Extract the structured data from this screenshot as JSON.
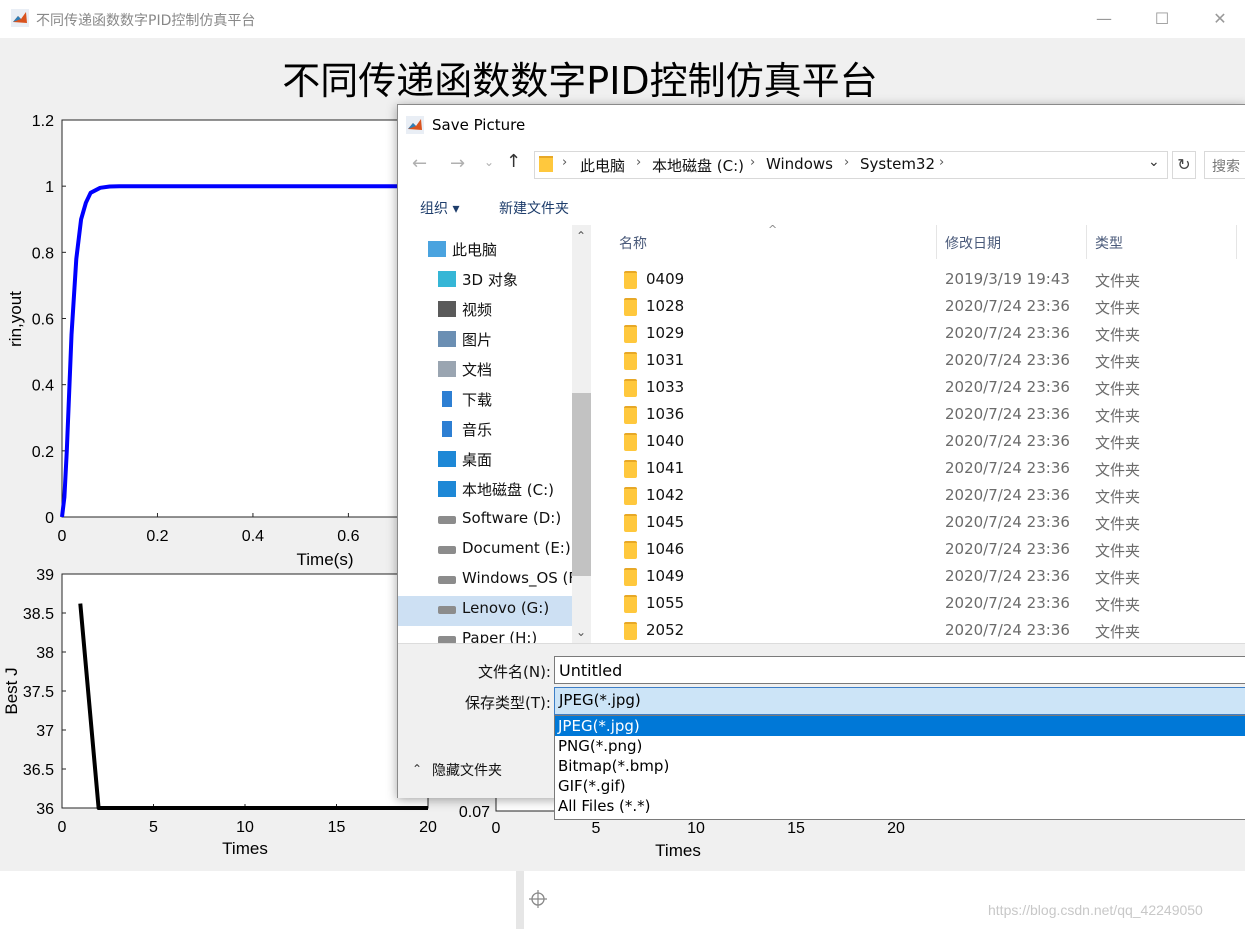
{
  "figure": {
    "window_title": "不同传递函数数字PID控制仿真平台",
    "heading": "不同传递函数数字PID控制仿真平台",
    "window_buttons": {
      "minimize": "—",
      "maximize": "☐",
      "close": "✕"
    }
  },
  "chart_data": [
    {
      "type": "line",
      "name": "response",
      "xlabel": "Time(s)",
      "ylabel": "rin,yout",
      "x_ticks": [
        "0",
        "0.2",
        "0.4",
        "0.6"
      ],
      "y_ticks": [
        "0",
        "0.2",
        "0.4",
        "0.6",
        "0.8",
        "1",
        "1.2"
      ],
      "xlim": [
        0,
        0.75
      ],
      "ylim": [
        0,
        1.2
      ],
      "series": [
        {
          "color": "#0000ff",
          "x": [
            0,
            0.005,
            0.01,
            0.02,
            0.03,
            0.04,
            0.05,
            0.06,
            0.08,
            0.1,
            0.12,
            0.15,
            0.2,
            0.4,
            0.6,
            0.75
          ],
          "y": [
            0,
            0.06,
            0.2,
            0.55,
            0.78,
            0.9,
            0.95,
            0.98,
            0.995,
            0.999,
            1.0,
            1.0,
            1.0,
            1.0,
            1.0,
            1.0
          ]
        }
      ]
    },
    {
      "type": "line",
      "name": "best-j",
      "xlabel": "Times",
      "ylabel": "Best J",
      "x_ticks": [
        "0",
        "5",
        "10",
        "15",
        "20"
      ],
      "y_ticks": [
        "36",
        "36.5",
        "37",
        "37.5",
        "38",
        "38.5",
        "39"
      ],
      "xlim": [
        0,
        20
      ],
      "ylim": [
        36,
        39
      ],
      "series": [
        {
          "color": "#000000",
          "x": [
            1,
            2,
            3,
            5,
            10,
            15,
            20
          ],
          "y": [
            38.62,
            36.0,
            36.0,
            36.0,
            36.0,
            36.0,
            36.0
          ]
        }
      ]
    },
    {
      "type": "line",
      "name": "partial-third",
      "xlabel": "Times",
      "x_ticks": [
        "0",
        "5",
        "10",
        "15",
        "20"
      ],
      "y_ticks": [
        "0.07"
      ],
      "xlim": [
        0,
        20
      ]
    }
  ],
  "dialog": {
    "title": "Save Picture",
    "breadcrumb": [
      "此电脑",
      "本地磁盘 (C:)",
      "Windows",
      "System32"
    ],
    "search_placeholder": "搜索",
    "toolbar": {
      "organize": "组织 ▾",
      "new_folder": "新建文件夹"
    },
    "nav_items": [
      {
        "label": "此电脑",
        "icon": "computer-icon"
      },
      {
        "label": "3D 对象",
        "icon": "3d-objects-icon"
      },
      {
        "label": "视频",
        "icon": "video-icon"
      },
      {
        "label": "图片",
        "icon": "pictures-icon"
      },
      {
        "label": "文档",
        "icon": "documents-icon"
      },
      {
        "label": "下载",
        "icon": "download-icon"
      },
      {
        "label": "音乐",
        "icon": "music-icon"
      },
      {
        "label": "桌面",
        "icon": "desktop-icon"
      },
      {
        "label": "本地磁盘 (C:)",
        "icon": "windows-drive-icon",
        "selected": true
      },
      {
        "label": "Software (D:)",
        "icon": "drive-icon"
      },
      {
        "label": "Document (E:)",
        "icon": "drive-icon"
      },
      {
        "label": "Windows_OS (F",
        "icon": "drive-icon"
      },
      {
        "label": "Lenovo (G:)",
        "icon": "drive-icon"
      },
      {
        "label": "Paper (H:)",
        "icon": "drive-icon"
      }
    ],
    "columns": {
      "name": "名称",
      "date": "修改日期",
      "type": "类型"
    },
    "files": [
      {
        "name": "0409",
        "date": "2019/3/19 19:43",
        "type": "文件夹"
      },
      {
        "name": "1028",
        "date": "2020/7/24 23:36",
        "type": "文件夹"
      },
      {
        "name": "1029",
        "date": "2020/7/24 23:36",
        "type": "文件夹"
      },
      {
        "name": "1031",
        "date": "2020/7/24 23:36",
        "type": "文件夹"
      },
      {
        "name": "1033",
        "date": "2020/7/24 23:36",
        "type": "文件夹"
      },
      {
        "name": "1036",
        "date": "2020/7/24 23:36",
        "type": "文件夹"
      },
      {
        "name": "1040",
        "date": "2020/7/24 23:36",
        "type": "文件夹"
      },
      {
        "name": "1041",
        "date": "2020/7/24 23:36",
        "type": "文件夹"
      },
      {
        "name": "1042",
        "date": "2020/7/24 23:36",
        "type": "文件夹"
      },
      {
        "name": "1045",
        "date": "2020/7/24 23:36",
        "type": "文件夹"
      },
      {
        "name": "1046",
        "date": "2020/7/24 23:36",
        "type": "文件夹"
      },
      {
        "name": "1049",
        "date": "2020/7/24 23:36",
        "type": "文件夹"
      },
      {
        "name": "1055",
        "date": "2020/7/24 23:36",
        "type": "文件夹"
      },
      {
        "name": "2052",
        "date": "2020/7/24 23:36",
        "type": "文件夹"
      }
    ],
    "filename_label": "文件名(N):",
    "filename_value": "Untitled",
    "filetype_label": "保存类型(T):",
    "filetype_selected": "JPEG(*.jpg)",
    "filetype_options": [
      "JPEG(*.jpg)",
      "PNG(*.png)",
      "Bitmap(*.bmp)",
      "GIF(*.gif)",
      "All Files (*.*)"
    ],
    "hide_folders": "隐藏文件夹"
  },
  "watermark": "https://blog.csdn.net/qq_42249050",
  "colors": {
    "accent": "#0078d7",
    "selection": "#cde0f3",
    "line_blue": "#0000ff"
  }
}
